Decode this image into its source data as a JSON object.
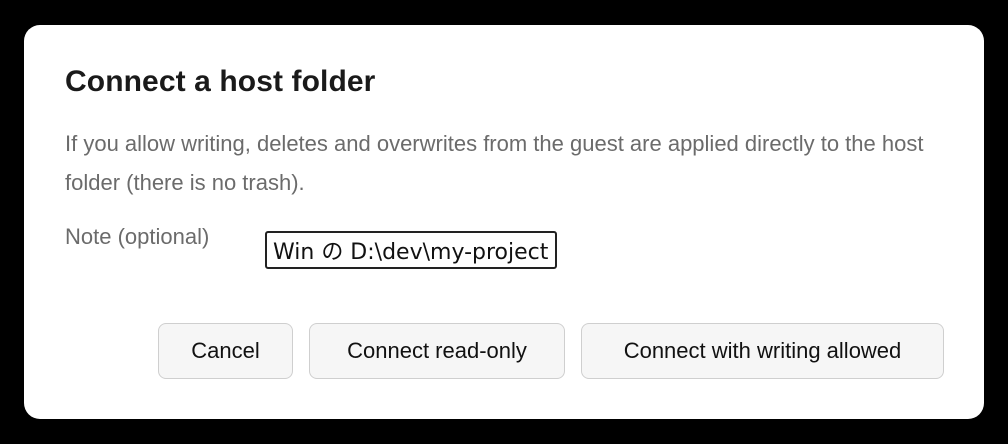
{
  "dialog": {
    "title": "Connect a host folder",
    "description": "If you allow writing, deletes and overwrites from the guest are applied directly to the host folder (there is no trash).",
    "note": {
      "label": "Note (optional)",
      "value": "Win の D:\\dev\\my-project"
    },
    "buttons": {
      "cancel": "Cancel",
      "read_only": "Connect read-only",
      "write": "Connect with writing allowed"
    }
  }
}
